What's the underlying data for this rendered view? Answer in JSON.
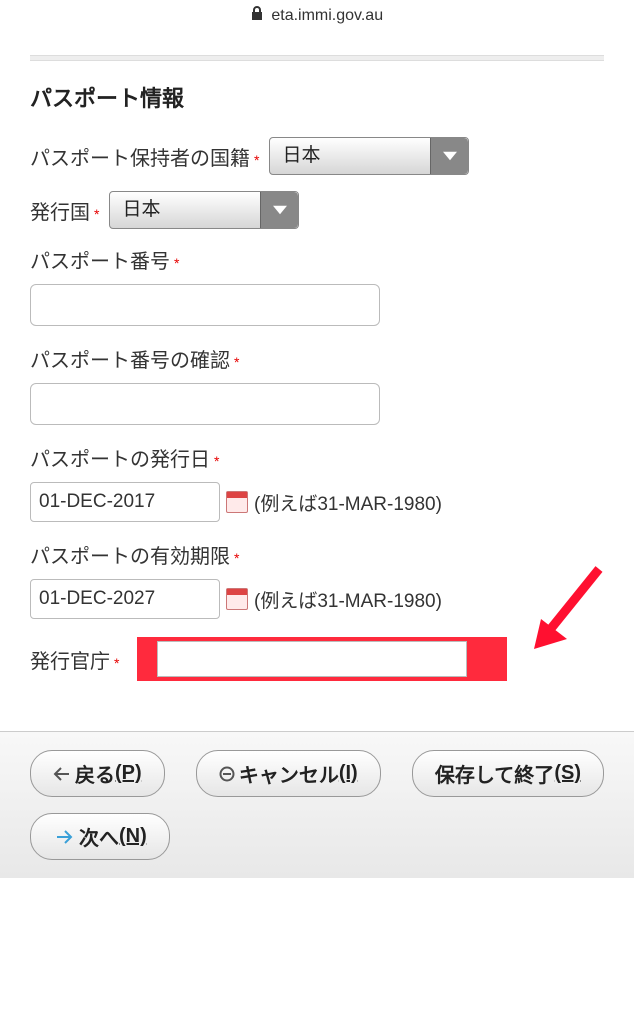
{
  "url": "eta.immi.gov.au",
  "section_title": "パスポート情報",
  "fields": {
    "nationality": {
      "label": "パスポート保持者の国籍",
      "value": "日本"
    },
    "issuing_country": {
      "label": "発行国",
      "value": "日本"
    },
    "passport_number": {
      "label": "パスポート番号",
      "value": ""
    },
    "passport_number_confirm": {
      "label": "パスポート番号の確認",
      "value": ""
    },
    "issue_date": {
      "label": "パスポートの発行日",
      "value": "01-DEC-2017",
      "example": "(例えば31-MAR-1980)"
    },
    "expiry_date": {
      "label": "パスポートの有効期限",
      "value": "01-DEC-2027",
      "example": "(例えば31-MAR-1980)"
    },
    "authority": {
      "label": "発行官庁",
      "value": ""
    }
  },
  "buttons": {
    "back": {
      "label": "戻る",
      "key": "(P)"
    },
    "cancel": {
      "label": "キャンセル",
      "key": "(I)"
    },
    "save_exit": {
      "label": "保存して終了",
      "key": "(S)"
    },
    "next": {
      "label": "次へ",
      "key": "(N)"
    }
  }
}
